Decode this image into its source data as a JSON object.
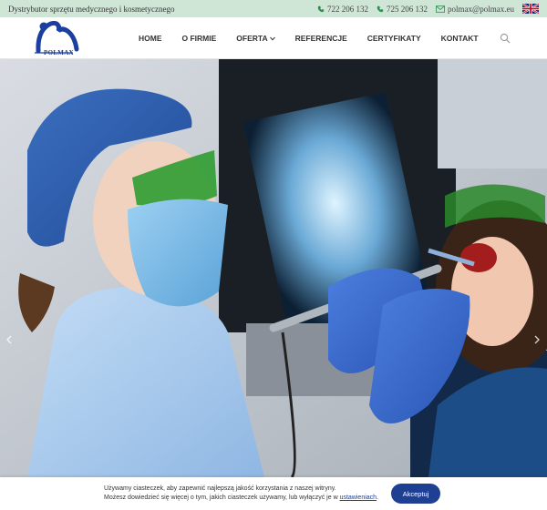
{
  "topbar": {
    "tagline": "Dystrybutor sprzętu medycznego i kosmetycznego",
    "phone1": "722 206 132",
    "phone2": "725 206 132",
    "email": "polmax@polmax.eu",
    "language_flag": "uk-flag-icon"
  },
  "header": {
    "logo_text": "POLMAX",
    "nav": [
      {
        "label": "HOME"
      },
      {
        "label": "O FIRMIE"
      },
      {
        "label": "OFERTA"
      },
      {
        "label": "REFERENCJE"
      },
      {
        "label": "CERTYFIKATY"
      },
      {
        "label": "KONTAKT"
      }
    ],
    "search_icon": "search-icon"
  },
  "hero": {
    "image": "dentist treating patient with green protective glasses",
    "prev_icon": "chevron-left-icon",
    "next_icon": "chevron-right-icon"
  },
  "cookie": {
    "line1": "Używamy ciasteczek, aby zapewnić najlepszą jakość korzystania z naszej witryny.",
    "line2_prefix": "Możesz dowiedzieć się więcej o tym, jakich ciasteczek używamy, lub wyłączyć je w",
    "line2_link": "ustawieniach",
    "line2_suffix": ".",
    "accept_label": "Akceptuj"
  },
  "colors": {
    "topbar_bg": "#cfe6d7",
    "accent": "#1f3f93",
    "contact_green": "#2d8f4e"
  }
}
